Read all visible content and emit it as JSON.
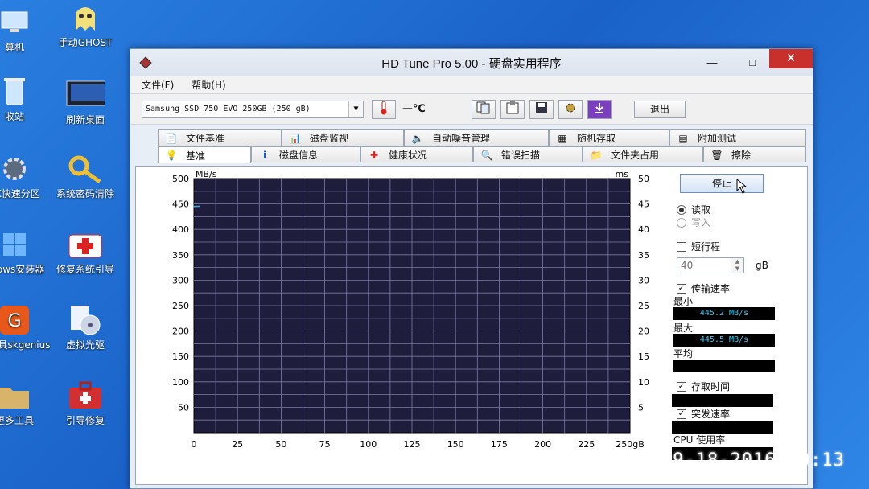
{
  "desktop": {
    "icons": [
      {
        "label": "算机",
        "icon": "computer-icon"
      },
      {
        "label": "手动GHOST",
        "icon": "ghost-icon"
      },
      {
        "label": "收站",
        "icon": "recycle-bin-icon"
      },
      {
        "label": "刷新桌面",
        "icon": "monitor-icon"
      },
      {
        "label": "SK快速分区",
        "icon": "gear-icon"
      },
      {
        "label": "系统密码清除",
        "icon": "key-icon"
      },
      {
        "label": "ndows安装器",
        "icon": "windows-icon"
      },
      {
        "label": "修复系统引导",
        "icon": "firstaid-icon"
      },
      {
        "label": "区工具skgenius",
        "icon": "diskgenius-icon"
      },
      {
        "label": "虚拟光驱",
        "icon": "cd-icon"
      },
      {
        "label": "更多工具",
        "icon": "folder-icon"
      },
      {
        "label": "引导修复",
        "icon": "toolbox-icon"
      }
    ]
  },
  "window": {
    "title": "HD Tune Pro 5.00 - 硬盘实用程序",
    "controls": {
      "minimize": "—",
      "maximize": "□",
      "close": "✕"
    }
  },
  "menu": {
    "file": "文件(F)",
    "help": "帮助(H)"
  },
  "toolbar": {
    "drive": "Samsung SSD 750 EVO 250GB (250 gB)",
    "temperature": "—℃",
    "exit_label": "退出"
  },
  "tabs": {
    "row1": [
      "文件基准",
      "磁盘监视",
      "自动噪音管理",
      "随机存取",
      "附加测试"
    ],
    "row2": [
      "基准",
      "磁盘信息",
      "健康状况",
      "错误扫描",
      "文件夹占用",
      "擦除"
    ],
    "active": "基准"
  },
  "chart_data": {
    "type": "line",
    "title": "",
    "ylabel_left": "MB/s",
    "ylabel_right": "ms",
    "xlim": [
      0,
      250
    ],
    "ylim_left": [
      0,
      500
    ],
    "ylim_right": [
      0,
      50
    ],
    "x_ticks": [
      "0",
      "25",
      "50",
      "75",
      "100",
      "125",
      "150",
      "175",
      "200",
      "225",
      "250gB"
    ],
    "y_left_ticks": [
      "50",
      "100",
      "150",
      "200",
      "250",
      "300",
      "350",
      "400",
      "450",
      "500"
    ],
    "y_right_ticks": [
      "5",
      "10",
      "15",
      "20",
      "25",
      "30",
      "35",
      "40",
      "45",
      "50"
    ],
    "series": [
      {
        "values": [
          [
            0,
            445.2
          ],
          [
            3,
            445.5
          ]
        ]
      }
    ],
    "grid": true,
    "background": "#1f1d3c",
    "grid_color": "#7d7aa6",
    "line_color": "#3fa9e0"
  },
  "controls": {
    "stop_label": "停止",
    "read_label": "读取",
    "write_label": "写入",
    "short_stroke_label": "短行程",
    "short_stroke_value": "40",
    "short_stroke_unit": "gB",
    "transfer_rate_label": "传输速率",
    "min_label": "最小",
    "min_value": "445.2 MB/s",
    "max_label": "最大",
    "max_value": "445.5 MB/s",
    "avg_label": "平均",
    "access_time_label": "存取时间",
    "burst_rate_label": "突发速率",
    "cpu_label": "CPU 使用率"
  },
  "photo_timestamp": "09-18-2016 10:13"
}
